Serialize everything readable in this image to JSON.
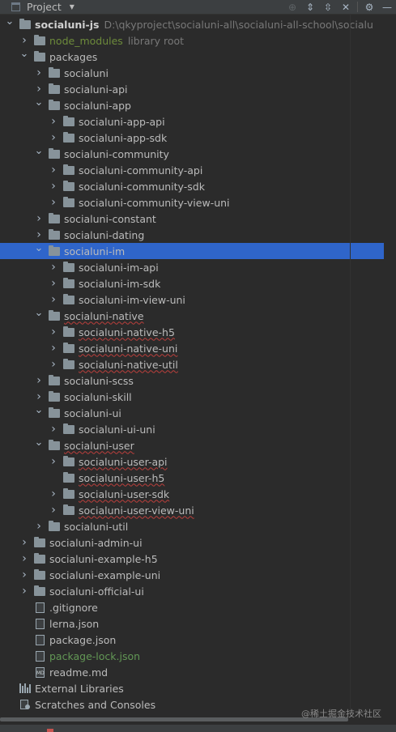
{
  "panel": {
    "title": "Project",
    "tools": [
      "target-icon",
      "expand-all-icon",
      "collapse-all-icon",
      "close-tab-icon",
      "gear-icon",
      "minimize-icon"
    ]
  },
  "tree": [
    {
      "depth": 0,
      "arrow": "down",
      "icon": "folder",
      "label": "socialuni-js",
      "bold": true,
      "extra": "D:\\qkyproject\\socialuni-all\\socialuni-all-school\\socialu"
    },
    {
      "depth": 1,
      "arrow": "right",
      "icon": "folder",
      "label": "node_modules",
      "color": "olive",
      "extra": "library root"
    },
    {
      "depth": 1,
      "arrow": "down",
      "icon": "folder",
      "label": "packages"
    },
    {
      "depth": 2,
      "arrow": "right",
      "icon": "folder",
      "label": "socialuni"
    },
    {
      "depth": 2,
      "arrow": "right",
      "icon": "folder",
      "label": "socialuni-api"
    },
    {
      "depth": 2,
      "arrow": "down",
      "icon": "folder",
      "label": "socialuni-app"
    },
    {
      "depth": 3,
      "arrow": "right",
      "icon": "folder",
      "label": "socialuni-app-api"
    },
    {
      "depth": 3,
      "arrow": "right",
      "icon": "folder",
      "label": "socialuni-app-sdk"
    },
    {
      "depth": 2,
      "arrow": "down",
      "icon": "folder",
      "label": "socialuni-community"
    },
    {
      "depth": 3,
      "arrow": "right",
      "icon": "folder",
      "label": "socialuni-community-api"
    },
    {
      "depth": 3,
      "arrow": "right",
      "icon": "folder",
      "label": "socialuni-community-sdk"
    },
    {
      "depth": 3,
      "arrow": "right",
      "icon": "folder",
      "label": "socialuni-community-view-uni"
    },
    {
      "depth": 2,
      "arrow": "right",
      "icon": "folder",
      "label": "socialuni-constant"
    },
    {
      "depth": 2,
      "arrow": "right",
      "icon": "folder",
      "label": "socialuni-dating"
    },
    {
      "depth": 2,
      "arrow": "down",
      "icon": "folder",
      "label": "socialuni-im",
      "selected": true
    },
    {
      "depth": 3,
      "arrow": "right",
      "icon": "folder",
      "label": "socialuni-im-api"
    },
    {
      "depth": 3,
      "arrow": "right",
      "icon": "folder",
      "label": "socialuni-im-sdk"
    },
    {
      "depth": 3,
      "arrow": "right",
      "icon": "folder",
      "label": "socialuni-im-view-uni"
    },
    {
      "depth": 2,
      "arrow": "down",
      "icon": "folder",
      "label": "socialuni-native"
    },
    {
      "depth": 3,
      "arrow": "right",
      "icon": "folder",
      "label": "socialuni-native-h5"
    },
    {
      "depth": 3,
      "arrow": "right",
      "icon": "folder",
      "label": "socialuni-native-uni"
    },
    {
      "depth": 3,
      "arrow": "right",
      "icon": "folder",
      "label": "socialuni-native-util"
    },
    {
      "depth": 2,
      "arrow": "right",
      "icon": "folder",
      "label": "socialuni-scss"
    },
    {
      "depth": 2,
      "arrow": "right",
      "icon": "folder",
      "label": "socialuni-skill"
    },
    {
      "depth": 2,
      "arrow": "down",
      "icon": "folder",
      "label": "socialuni-ui"
    },
    {
      "depth": 3,
      "arrow": "right",
      "icon": "folder",
      "label": "socialuni-ui-uni"
    },
    {
      "depth": 2,
      "arrow": "down",
      "icon": "folder",
      "label": "socialuni-user"
    },
    {
      "depth": 3,
      "arrow": "right",
      "icon": "folder",
      "label": "socialuni-user-api"
    },
    {
      "depth": 3,
      "arrow": "none",
      "icon": "folder",
      "label": "socialuni-user-h5"
    },
    {
      "depth": 3,
      "arrow": "right",
      "icon": "folder",
      "label": "socialuni-user-sdk"
    },
    {
      "depth": 3,
      "arrow": "right",
      "icon": "folder",
      "label": "socialuni-user-view-uni"
    },
    {
      "depth": 2,
      "arrow": "right",
      "icon": "folder",
      "label": "socialuni-util"
    },
    {
      "depth": 1,
      "arrow": "right",
      "icon": "folder",
      "label": "socialuni-admin-ui"
    },
    {
      "depth": 1,
      "arrow": "right",
      "icon": "folder",
      "label": "socialuni-example-h5"
    },
    {
      "depth": 1,
      "arrow": "right",
      "icon": "folder",
      "label": "socialuni-example-uni"
    },
    {
      "depth": 1,
      "arrow": "right",
      "icon": "folder",
      "label": "socialuni-official-ui"
    },
    {
      "depth": 1,
      "arrow": "none",
      "icon": "file",
      "label": ".gitignore"
    },
    {
      "depth": 1,
      "arrow": "none",
      "icon": "file",
      "label": "lerna.json"
    },
    {
      "depth": 1,
      "arrow": "none",
      "icon": "file",
      "label": "package.json"
    },
    {
      "depth": 1,
      "arrow": "none",
      "icon": "file",
      "label": "package-lock.json",
      "color": "green"
    },
    {
      "depth": 1,
      "arrow": "none",
      "icon": "file",
      "label": "readme.md",
      "filetag": "MD"
    },
    {
      "depth": 0,
      "arrow": "none",
      "icon": "library",
      "label": "External Libraries"
    },
    {
      "depth": 0,
      "arrow": "none",
      "icon": "scratch",
      "label": "Scratches and Consoles"
    }
  ],
  "watermark": "@稀土掘金技术社区"
}
